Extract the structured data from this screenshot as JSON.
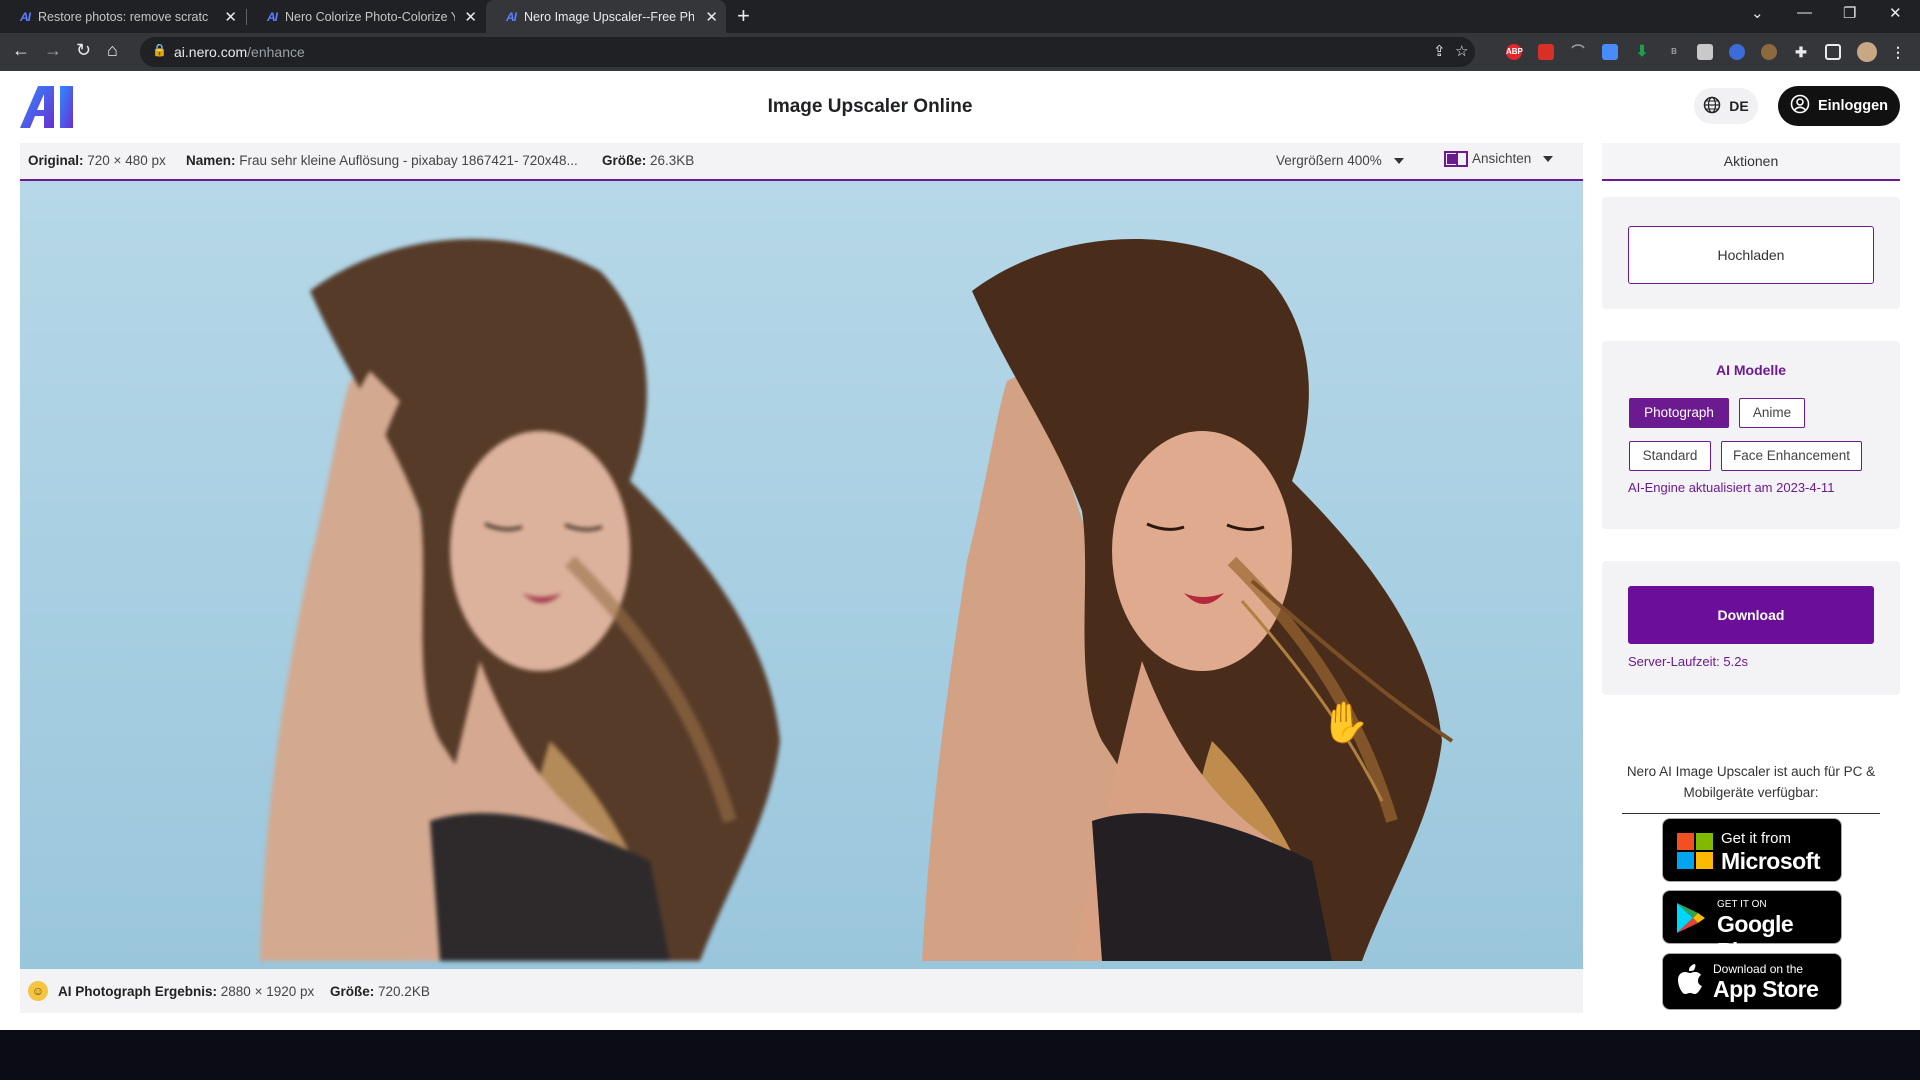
{
  "browser": {
    "tabs": [
      {
        "title": "Restore photos: remove scratche",
        "favicon": "AI"
      },
      {
        "title": "Nero Colorize Photo-Colorize Yo",
        "favicon": "AI"
      },
      {
        "title": "Nero Image Upscaler--Free Phot",
        "favicon": "AI",
        "active": true
      }
    ],
    "url_host": "ai.nero.com",
    "url_path": "/enhance",
    "extension_abp": "ABP"
  },
  "header": {
    "logo": "AI",
    "title": "Image Upscaler Online",
    "language": "DE",
    "login_label": "Einloggen"
  },
  "infobar": {
    "original_label": "Original:",
    "original_value": "720 × 480 px",
    "name_label": "Namen:",
    "name_value": "Frau sehr kleine Auflösung - pixabay 1867421- 720x48...",
    "size_label": "Größe:",
    "size_value": "26.3KB",
    "zoom_label": "Vergrößern 400%",
    "view_label": "Ansichten"
  },
  "result": {
    "label": "AI Photograph Ergebnis:",
    "dims": "2880 × 1920 px",
    "size_label": "Größe:",
    "size_value": "720.2KB"
  },
  "panel": {
    "tab_label": "Aktionen",
    "upload_label": "Hochladen",
    "models_title": "AI Modelle",
    "models": [
      {
        "label": "Photograph",
        "selected": true
      },
      {
        "label": "Anime",
        "selected": false
      },
      {
        "label": "Standard",
        "selected": false
      },
      {
        "label": "Face Enhancement",
        "selected": false
      }
    ],
    "engine_note": "AI-Engine aktualisiert am 2023-4-11",
    "download_label": "Download",
    "server_note": "Server-Laufzeit: 5.2s",
    "availability": "Nero AI Image Upscaler ist auch für PC & Mobilgeräte verfügbar:",
    "stores": {
      "microsoft_small": "Get it from",
      "microsoft_big": "Microsoft",
      "google_small": "GET IT ON",
      "google_big": "Google Play",
      "apple_small": "Download on the",
      "apple_big": "App Store"
    }
  },
  "colors": {
    "accent": "#6b1b8f",
    "download": "#6b0e9a",
    "sky": "#a9cfe0"
  }
}
